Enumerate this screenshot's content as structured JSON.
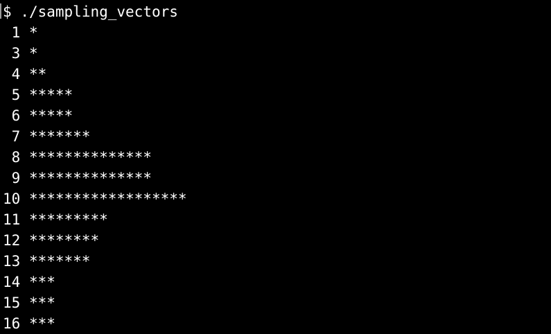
{
  "terminal": {
    "prompt": "$",
    "command": "./sampling_vectors"
  },
  "rows": [
    {
      "label": "1",
      "stars": "*"
    },
    {
      "label": "3",
      "stars": "*"
    },
    {
      "label": "4",
      "stars": "**"
    },
    {
      "label": "5",
      "stars": "*****"
    },
    {
      "label": "6",
      "stars": "*****"
    },
    {
      "label": "7",
      "stars": "*******"
    },
    {
      "label": "8",
      "stars": "**************"
    },
    {
      "label": "9",
      "stars": "**************"
    },
    {
      "label": "10",
      "stars": "******************"
    },
    {
      "label": "11",
      "stars": "*********"
    },
    {
      "label": "12",
      "stars": "********"
    },
    {
      "label": "13",
      "stars": "*******"
    },
    {
      "label": "14",
      "stars": "***"
    },
    {
      "label": "15",
      "stars": "***"
    },
    {
      "label": "16",
      "stars": "***"
    }
  ],
  "colors": {
    "background": "#000000",
    "foreground": "#ffffff"
  }
}
